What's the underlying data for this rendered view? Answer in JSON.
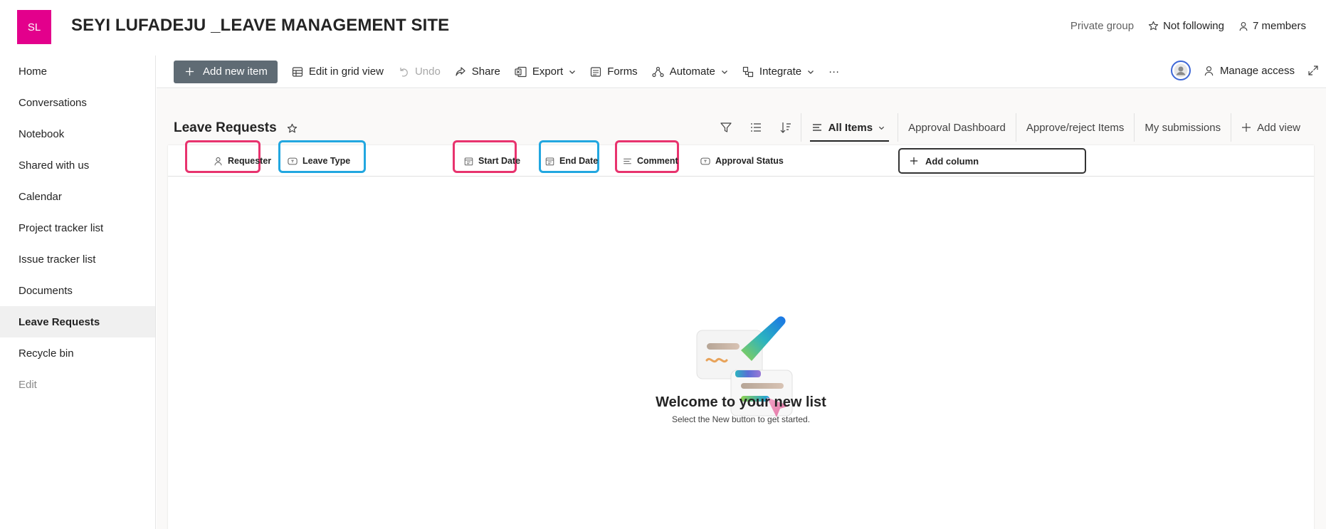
{
  "header": {
    "logo_text": "SL",
    "site_title": "SEYI LUFADEJU _LEAVE MANAGEMENT SITE",
    "privacy": "Private group",
    "follow_label": "Not following",
    "members_label": "7 members",
    "logo_color": "#e3008c"
  },
  "nav": {
    "items": [
      {
        "label": "Home"
      },
      {
        "label": "Conversations"
      },
      {
        "label": "Notebook"
      },
      {
        "label": "Shared with us"
      },
      {
        "label": "Calendar"
      },
      {
        "label": "Project tracker list"
      },
      {
        "label": "Issue tracker list"
      },
      {
        "label": "Documents"
      },
      {
        "label": "Leave Requests",
        "active": true
      },
      {
        "label": "Recycle bin"
      },
      {
        "label": "Edit"
      }
    ]
  },
  "command_bar": {
    "add_new_item": "Add new item",
    "edit_grid": "Edit in grid view",
    "undo": "Undo",
    "share": "Share",
    "export": "Export",
    "forms": "Forms",
    "automate": "Automate",
    "integrate": "Integrate",
    "more": "···",
    "manage_access": "Manage access"
  },
  "list": {
    "title": "Leave Requests",
    "views": {
      "current": "All Items",
      "tabs": [
        "Approval Dashboard",
        "Approve/reject Items",
        "My submissions"
      ],
      "add_view": "Add view"
    },
    "columns": [
      {
        "label": "Requester",
        "icon": "person-icon",
        "highlight": "pink"
      },
      {
        "label": "Leave Type",
        "icon": "choice-icon",
        "highlight": "blue"
      },
      {
        "label": "Start Date",
        "icon": "calendar-icon",
        "highlight": "pink"
      },
      {
        "label": "End Date",
        "icon": "calendar-icon",
        "highlight": "blue"
      },
      {
        "label": "Comment",
        "icon": "text-lines-icon",
        "highlight": "pink"
      },
      {
        "label": "Approval Status",
        "icon": "choice-icon",
        "highlight": "none"
      }
    ],
    "add_column": "Add column",
    "empty_title": "Welcome to your new list",
    "empty_subtitle": "Select the New button to get started.",
    "highlight_colors": {
      "pink": "#e8336e",
      "blue": "#22a7e0"
    }
  }
}
